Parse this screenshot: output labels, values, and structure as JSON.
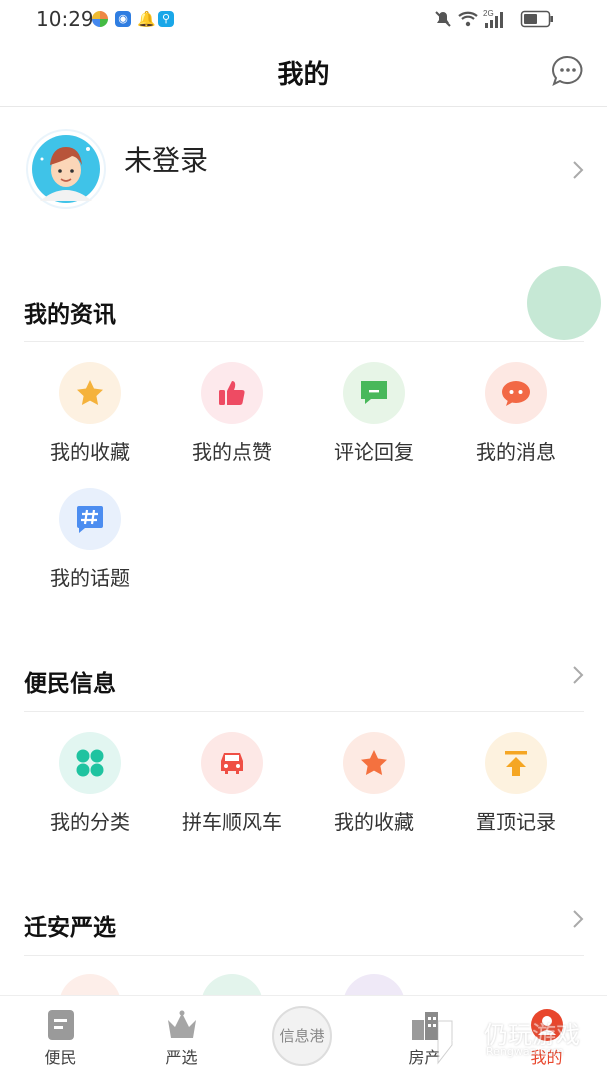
{
  "status_bar": {
    "time": "10:29",
    "network_label": "2G",
    "icons": [
      "colorful-app-icon",
      "bulb-app-icon",
      "qq-bell-icon",
      "search-app-icon",
      "mute-bell-icon",
      "wifi-icon",
      "signal-icon",
      "battery-icon"
    ]
  },
  "header": {
    "title": "我的",
    "message_icon": "chat-bubble-icon"
  },
  "profile": {
    "name": "未登录",
    "avatar_icon": "cartoon-avatar"
  },
  "sections": {
    "news": {
      "title": "我的资讯",
      "items": [
        {
          "label": "我的收藏",
          "icon": "star-icon",
          "bg": "#fdf1e1",
          "color": "#f5b23b"
        },
        {
          "label": "我的点赞",
          "icon": "thumbs-up-icon",
          "bg": "#fde9ec",
          "color": "#ee4b63"
        },
        {
          "label": "评论回复",
          "icon": "comment-icon",
          "bg": "#e7f5e7",
          "color": "#48b85a"
        },
        {
          "label": "我的消息",
          "icon": "message-icon",
          "bg": "#fde8e3",
          "color": "#f26845"
        },
        {
          "label": "我的话题",
          "icon": "hashtag-icon",
          "bg": "#e8f0fc",
          "color": "#4c8df0"
        }
      ]
    },
    "convenience": {
      "title": "便民信息",
      "items": [
        {
          "label": "我的分类",
          "icon": "category-icon",
          "bg": "#e2f6f1",
          "color": "#1fc3a0"
        },
        {
          "label": "拼车顺风车",
          "icon": "car-icon",
          "bg": "#fde8e6",
          "color": "#ef4f45"
        },
        {
          "label": "我的收藏",
          "icon": "star-icon",
          "bg": "#fdeae3",
          "color": "#f4713f"
        },
        {
          "label": "置顶记录",
          "icon": "pin-top-icon",
          "bg": "#fdf2df",
          "color": "#f5a623"
        }
      ]
    },
    "selection": {
      "title": "迁安严选"
    }
  },
  "tab_bar": {
    "tabs": [
      {
        "label": "便民",
        "icon": "notebook-icon"
      },
      {
        "label": "严选",
        "icon": "crown-icon"
      },
      {
        "label": "信息港",
        "icon": "center-logo"
      },
      {
        "label": "房产",
        "icon": "building-icon"
      },
      {
        "label": "我的",
        "icon": "user-icon",
        "active": true
      }
    ],
    "active_color": "#e8462c"
  },
  "watermark": {
    "text": "仍玩游戏",
    "sub": "Rengwan.com"
  }
}
